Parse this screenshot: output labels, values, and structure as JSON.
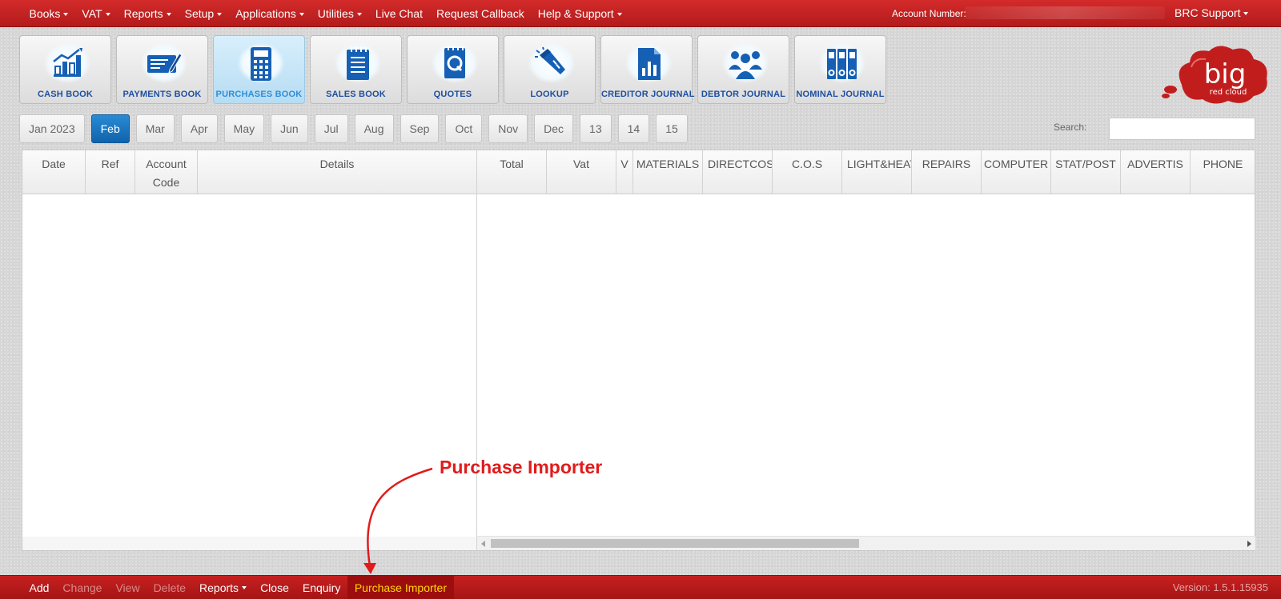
{
  "topbar": {
    "menu": [
      {
        "label": "Books",
        "dropdown": true
      },
      {
        "label": "VAT",
        "dropdown": true
      },
      {
        "label": "Reports",
        "dropdown": true
      },
      {
        "label": "Setup",
        "dropdown": true
      },
      {
        "label": "Applications",
        "dropdown": true
      },
      {
        "label": "Utilities",
        "dropdown": true
      },
      {
        "label": "Live Chat",
        "dropdown": false
      },
      {
        "label": "Request Callback",
        "dropdown": false
      },
      {
        "label": "Help & Support",
        "dropdown": true
      }
    ],
    "account_label": "Account Number:",
    "support_label": "BRC Support"
  },
  "tiles": [
    {
      "label": "CASH BOOK",
      "icon": "bar-chart-icon",
      "active": false
    },
    {
      "label": "PAYMENTS BOOK",
      "icon": "cheque-pen-icon",
      "active": false
    },
    {
      "label": "PURCHASES BOOK",
      "icon": "calculator-icon",
      "active": true
    },
    {
      "label": "SALES BOOK",
      "icon": "notepad-icon",
      "active": false
    },
    {
      "label": "QUOTES",
      "icon": "quote-document-icon",
      "active": false
    },
    {
      "label": "LOOKUP",
      "icon": "flashlight-icon",
      "active": false
    },
    {
      "label": "CREDITOR JOURNAL",
      "icon": "chart-document-icon",
      "active": false
    },
    {
      "label": "DEBTOR JOURNAL",
      "icon": "people-group-icon",
      "active": false
    },
    {
      "label": "NOMINAL JOURNAL",
      "icon": "binders-icon",
      "active": false
    }
  ],
  "logo": {
    "main": "big",
    "sub": "red cloud"
  },
  "months": [
    {
      "label": "Jan 2023",
      "active": false
    },
    {
      "label": "Feb",
      "active": true
    },
    {
      "label": "Mar",
      "active": false
    },
    {
      "label": "Apr",
      "active": false
    },
    {
      "label": "May",
      "active": false
    },
    {
      "label": "Jun",
      "active": false
    },
    {
      "label": "Jul",
      "active": false
    },
    {
      "label": "Aug",
      "active": false
    },
    {
      "label": "Sep",
      "active": false
    },
    {
      "label": "Oct",
      "active": false
    },
    {
      "label": "Nov",
      "active": false
    },
    {
      "label": "Dec",
      "active": false
    },
    {
      "label": "13",
      "active": false
    },
    {
      "label": "14",
      "active": false
    },
    {
      "label": "15",
      "active": false
    }
  ],
  "search": {
    "label": "Search:",
    "value": ""
  },
  "grid": {
    "columns": [
      "Date",
      "Ref",
      "Account\nCode",
      "Details",
      "Total",
      "Vat",
      "V",
      "MATERIALS",
      "DIRECTCOS",
      "C.O.S",
      "LIGHT&HEAT",
      "REPAIRS",
      "COMPUTER",
      "STAT/POST",
      "ADVERTIS",
      "PHONE"
    ]
  },
  "annotation": {
    "label": "Purchase Importer",
    "color": "#e11b1b"
  },
  "bottombar": {
    "items": [
      {
        "label": "Add",
        "state": "enabled"
      },
      {
        "label": "Change",
        "state": "disabled"
      },
      {
        "label": "View",
        "state": "disabled"
      },
      {
        "label": "Delete",
        "state": "disabled"
      },
      {
        "label": "Reports",
        "state": "dropdown"
      },
      {
        "label": "Close",
        "state": "enabled"
      },
      {
        "label": "Enquiry",
        "state": "enabled"
      },
      {
        "label": "Purchase Importer",
        "state": "highlight"
      }
    ],
    "version": "Version: 1.5.1.15935"
  },
  "colors": {
    "brand_red": "#c72020",
    "active_blue": "#1470bd",
    "tile_text": "#1f4fa0",
    "highlight_yellow": "#ffd800"
  }
}
